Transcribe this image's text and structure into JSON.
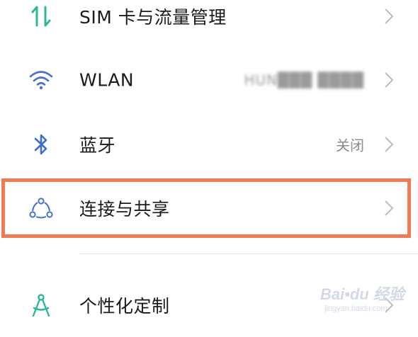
{
  "settings": {
    "items": [
      {
        "label": "SIM 卡与流量管理",
        "value": "",
        "icon": "data-transfer-icon"
      },
      {
        "label": "WLAN",
        "value": "HUN███ ████",
        "icon": "wifi-icon"
      },
      {
        "label": "蓝牙",
        "value": "关闭",
        "icon": "bluetooth-icon"
      },
      {
        "label": "连接与共享",
        "value": "",
        "icon": "share-connection-icon"
      },
      {
        "label": "个性化定制",
        "value": "",
        "icon": "personalize-compass-icon"
      }
    ]
  },
  "colors": {
    "highlight_border": "#ee7a56",
    "sim_icon": "#2fb79a",
    "wifi_icon": "#4a6fd0",
    "bluetooth_icon": "#3d6fc9",
    "share_icon": "#4a6fd0",
    "personalize_icon": "#2fb79a",
    "watermark": "#cfd6e4"
  },
  "watermark": {
    "main": "Bai•du 经验",
    "sub": "jingyan.baidu.com"
  }
}
